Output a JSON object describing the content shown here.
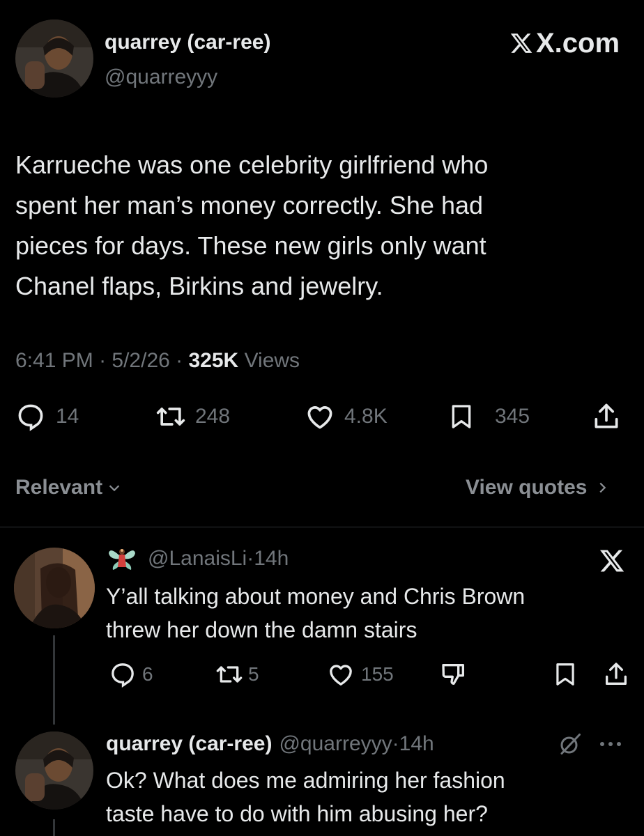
{
  "main_tweet": {
    "author_name": "quarrey (car-ree)",
    "handle": "@quarreyyy",
    "watermark": "X.com",
    "text_lines": [
      "Karrueche was one celebrity girlfriend who",
      "spent her man’s money correctly. She had",
      "pieces for days. These new girls only want",
      "Chanel flaps, Birkins and jewelry."
    ],
    "time": "6:41 PM",
    "date": "5/2/26",
    "views_count": "325K",
    "views_label": "Views",
    "replies": "14",
    "reposts": "248",
    "likes": "4.8K",
    "bookmarks": "345"
  },
  "filters": {
    "sort_label": "Relevant",
    "view_quotes_label": "View quotes"
  },
  "reply_1": {
    "handle": "@LanaisLi",
    "time": "14h",
    "text_lines": [
      "Y’all talking about money and Chris Brown",
      "threw her down the damn stairs"
    ],
    "replies": "6",
    "reposts": "5",
    "likes": "155"
  },
  "reply_2": {
    "author_name": "quarrey (car-ree)",
    "handle": "@quarreyyy",
    "time": "14h",
    "text_lines": [
      "Ok? What does me admiring her fashion",
      "taste have to do with him abusing her?"
    ]
  },
  "colors": {
    "background": "#000000",
    "text": "#e7e9ea",
    "muted": "#71767b",
    "divider": "#2f3336"
  },
  "icons": [
    "reply-icon",
    "repost-icon",
    "like-icon",
    "bookmark-icon",
    "share-icon",
    "dislike-icon",
    "x-logo-icon",
    "grok-icon",
    "more-icon",
    "chevron-down-icon",
    "chevron-right-icon",
    "fairy-emoji-icon"
  ]
}
